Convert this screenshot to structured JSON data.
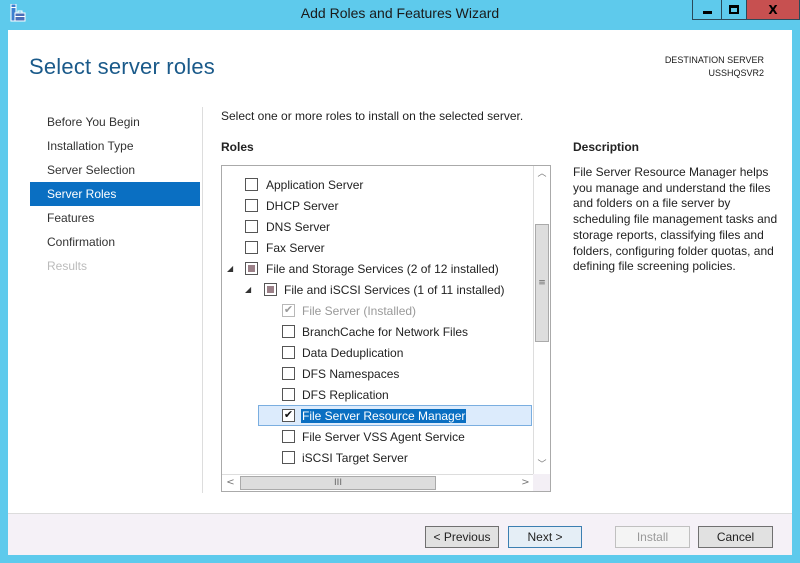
{
  "window": {
    "title": "Add Roles and Features Wizard",
    "controls": {
      "minimize": "minimize",
      "maximize": "maximize",
      "close": "X"
    }
  },
  "header": {
    "page_title": "Select server roles",
    "destination_label": "DESTINATION SERVER",
    "destination_server": "USSHQSVR2"
  },
  "nav": {
    "items": [
      {
        "label": "Before You Begin",
        "state": "normal"
      },
      {
        "label": "Installation Type",
        "state": "normal"
      },
      {
        "label": "Server Selection",
        "state": "normal"
      },
      {
        "label": "Server Roles",
        "state": "active"
      },
      {
        "label": "Features",
        "state": "normal"
      },
      {
        "label": "Confirmation",
        "state": "normal"
      },
      {
        "label": "Results",
        "state": "disabled"
      }
    ]
  },
  "main": {
    "instruction": "Select one or more roles to install on the selected server.",
    "roles_header": "Roles",
    "roles": [
      {
        "label": "Application Server",
        "level": 0,
        "checked": "none",
        "expandable": false
      },
      {
        "label": "DHCP Server",
        "level": 0,
        "checked": "none",
        "expandable": false
      },
      {
        "label": "DNS Server",
        "level": 0,
        "checked": "none",
        "expandable": false
      },
      {
        "label": "Fax Server",
        "level": 0,
        "checked": "none",
        "expandable": false
      },
      {
        "label": "File and Storage Services (2 of 12 installed)",
        "level": 0,
        "checked": "partial",
        "expandable": true,
        "expanded": true
      },
      {
        "label": "File and iSCSI Services (1 of 11 installed)",
        "level": 1,
        "checked": "partial",
        "expandable": true,
        "expanded": true
      },
      {
        "label": "File Server (Installed)",
        "level": 2,
        "checked": "checked",
        "disabled": true
      },
      {
        "label": "BranchCache for Network Files",
        "level": 2,
        "checked": "none"
      },
      {
        "label": "Data Deduplication",
        "level": 2,
        "checked": "none"
      },
      {
        "label": "DFS Namespaces",
        "level": 2,
        "checked": "none"
      },
      {
        "label": "DFS Replication",
        "level": 2,
        "checked": "none"
      },
      {
        "label": "File Server Resource Manager",
        "level": 2,
        "checked": "checked",
        "selected": true
      },
      {
        "label": "File Server VSS Agent Service",
        "level": 2,
        "checked": "none"
      },
      {
        "label": "iSCSI Target Server",
        "level": 2,
        "checked": "none"
      }
    ]
  },
  "description": {
    "header": "Description",
    "text": "File Server Resource Manager helps you manage and understand the files and folders on a file server by scheduling file management tasks and storage reports, classifying files and folders, configuring folder quotas, and defining file screening policies."
  },
  "footer": {
    "previous": "< Previous",
    "next": "Next >",
    "install": "Install",
    "cancel": "Cancel"
  },
  "glyphs": {
    "expanded": "◢",
    "check": "✔",
    "up": "︿",
    "down": "﹀",
    "left": "<",
    "right": ">",
    "grip_v": "≡",
    "grip_h": "III"
  }
}
